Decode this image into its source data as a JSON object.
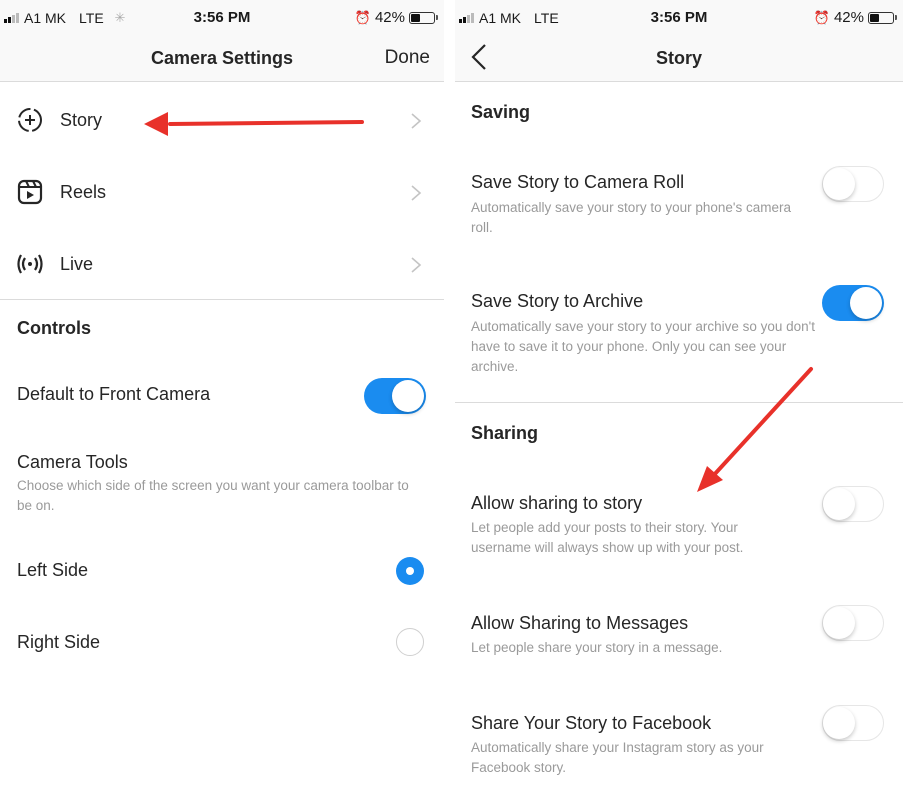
{
  "left": {
    "status_bar": {
      "carrier": "A1 MK",
      "network": "LTE",
      "time": "3:56 PM",
      "battery_percent": "42%",
      "battery_level": 0.42,
      "signal_bars_active": 2,
      "icons": [
        "signal-icon",
        "loading-spinner-icon",
        "alarm-icon",
        "battery-icon"
      ]
    },
    "nav": {
      "title": "Camera Settings",
      "done_label": "Done"
    },
    "menu_items": [
      {
        "label": "Story",
        "icon": "story-add-icon"
      },
      {
        "label": "Reels",
        "icon": "reels-icon"
      },
      {
        "label": "Live",
        "icon": "live-broadcast-icon"
      }
    ],
    "controls": {
      "header": "Controls",
      "default_front_camera": {
        "label": "Default to Front Camera",
        "on": true
      },
      "camera_tools": {
        "label": "Camera Tools",
        "description": "Choose which side of the screen you want your camera toolbar to be on.",
        "options": [
          {
            "label": "Left Side",
            "selected": true
          },
          {
            "label": "Right Side",
            "selected": false
          }
        ]
      }
    }
  },
  "right": {
    "status_bar": {
      "carrier": "A1 MK",
      "network": "LTE",
      "time": "3:56 PM",
      "battery_percent": "42%",
      "battery_level": 0.42,
      "signal_bars_active": 2,
      "icons": [
        "signal-icon",
        "alarm-icon",
        "battery-icon"
      ]
    },
    "nav": {
      "title": "Story",
      "back_icon": "chevron-left-icon"
    },
    "sections": [
      {
        "header": "Saving",
        "settings": [
          {
            "label": "Save Story to Camera Roll",
            "description": "Automatically save your story to your phone's camera roll.",
            "on": false
          },
          {
            "label": "Save Story to Archive",
            "description": "Automatically save your story to your archive so you don't have to save it to your phone. Only you can see your archive.",
            "on": true
          }
        ]
      },
      {
        "header": "Sharing",
        "settings": [
          {
            "label": "Allow sharing to story",
            "description": "Let people add your posts to their story. Your username will always show up with your post.",
            "on": false
          },
          {
            "label": "Allow Sharing to Messages",
            "description": "Let people share your story in a message.",
            "on": false
          },
          {
            "label": "Share Your Story to Facebook",
            "description": "Automatically share your Instagram story as your Facebook story.",
            "on": false
          }
        ]
      }
    ]
  },
  "annotations": {
    "arrow_color": "#e8312a",
    "arrows": [
      "pointing-to-story-menu-item",
      "pointing-to-allow-sharing-to-story"
    ]
  },
  "colors": {
    "accent_blue": "#1a8cf0",
    "text_primary": "#262626",
    "text_secondary": "#9a9a9a",
    "divider": "#dbdbdb",
    "bar_background": "#f9f9f9"
  }
}
